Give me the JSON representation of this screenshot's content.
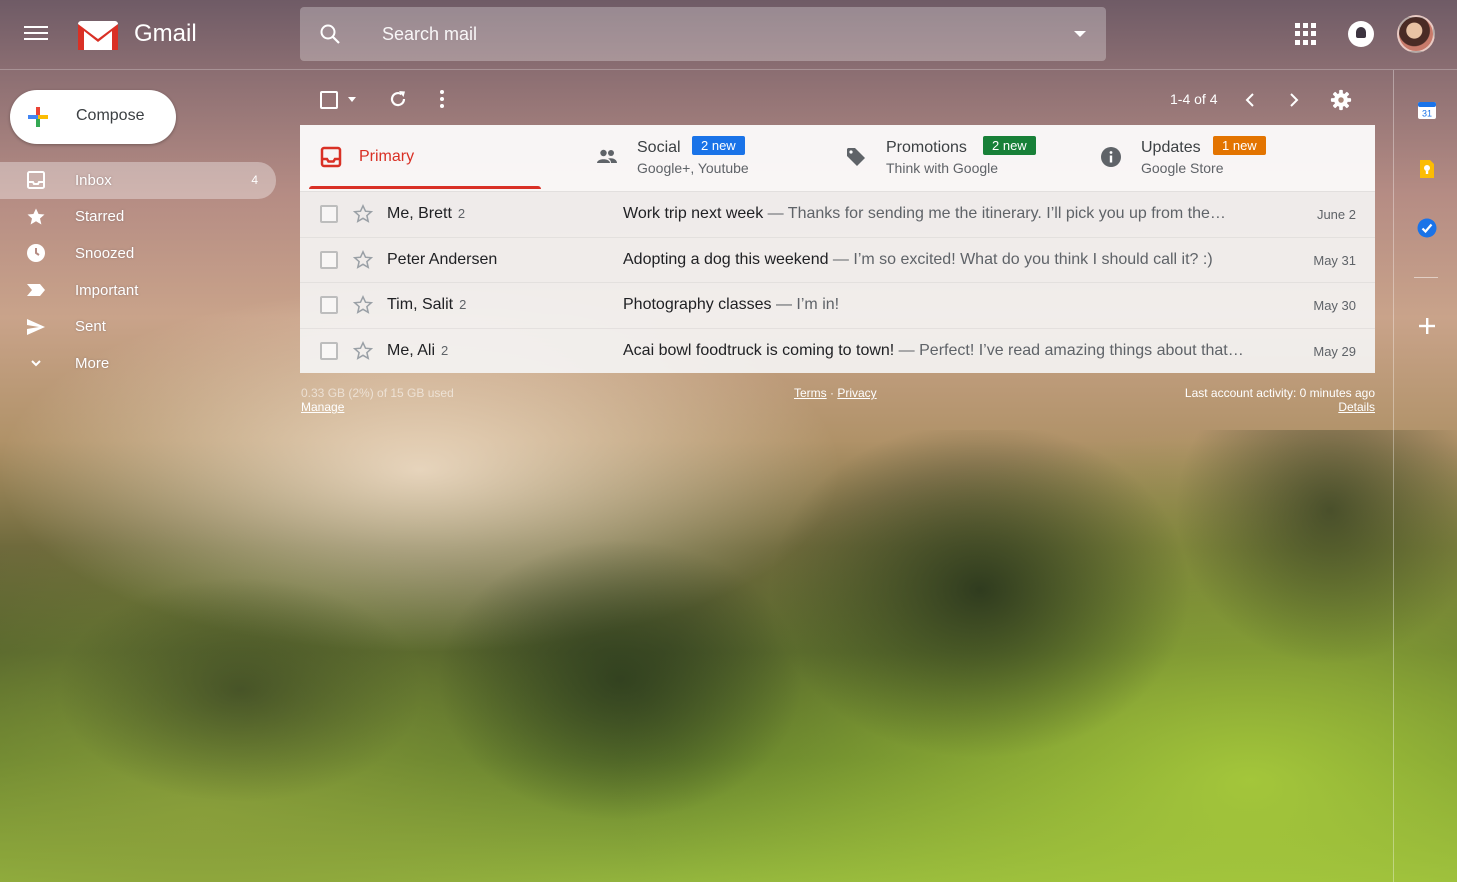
{
  "app": {
    "name": "Gmail"
  },
  "search": {
    "placeholder": "Search mail"
  },
  "compose": {
    "label": "Compose"
  },
  "nav": [
    {
      "label": "Inbox",
      "count": "4",
      "icon": "inbox-icon",
      "active": true
    },
    {
      "label": "Starred",
      "icon": "star-icon"
    },
    {
      "label": "Snoozed",
      "icon": "clock-icon"
    },
    {
      "label": "Important",
      "icon": "important-icon"
    },
    {
      "label": "Sent",
      "icon": "send-icon"
    },
    {
      "label": "More",
      "icon": "chevron-down-icon"
    }
  ],
  "toolbar": {
    "pager": "1-4 of 4"
  },
  "tabs": {
    "primary": {
      "title": "Primary"
    },
    "social": {
      "title": "Social",
      "badge": "2 new",
      "sub": "Google+, Youtube",
      "color": "#1a73e8"
    },
    "promotions": {
      "title": "Promotions",
      "badge": "2 new",
      "sub": "Think with Google",
      "color": "#188038"
    },
    "updates": {
      "title": "Updates",
      "badge": "1 new",
      "sub": "Google Store",
      "color": "#e37400"
    }
  },
  "emails": [
    {
      "sender": "Me, Brett",
      "count": "2",
      "subject": "Work trip next week",
      "snippet": " — Thanks for sending me the itinerary. I’ll pick you up from the…",
      "date": "June 2"
    },
    {
      "sender": "Peter Andersen",
      "count": "",
      "subject": "Adopting a dog this weekend",
      "snippet": " — I’m so excited! What do you think I should call it? :)",
      "date": "May 31"
    },
    {
      "sender": "Tim, Salit",
      "count": "2",
      "subject": "Photography classes",
      "snippet": " — I’m in!",
      "date": "May 30"
    },
    {
      "sender": "Me, Ali",
      "count": "2",
      "subject": "Acai bowl foodtruck is coming to town!",
      "snippet": " — Perfect! I’ve read amazing things about that…",
      "date": "May 29"
    }
  ],
  "footer": {
    "storage": "0.33 GB (2%) of 15 GB used",
    "manage": "Manage",
    "terms": "Terms",
    "sep": " · ",
    "privacy": "Privacy",
    "activity": "Last account activity: 0 minutes ago",
    "details": "Details"
  },
  "rail": {
    "calendar_day": "31"
  },
  "colors": {
    "accent": "#d93025",
    "brand_red": "#ea4335"
  }
}
